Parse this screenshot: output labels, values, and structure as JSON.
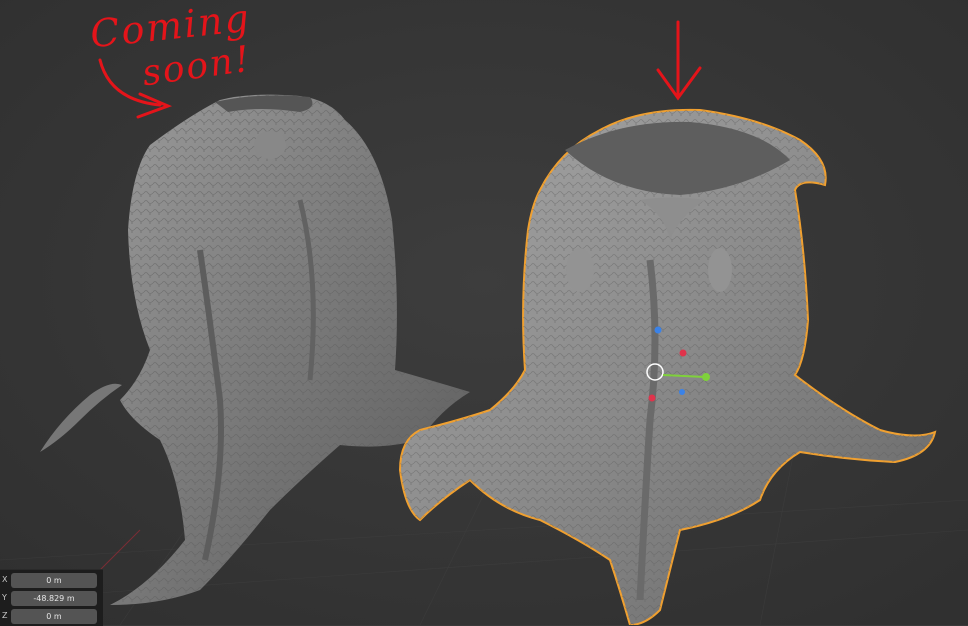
{
  "annotation": {
    "line1": "Coming",
    "line2": "soon!",
    "color": "#e4141a"
  },
  "viewport": {
    "background": "#393939",
    "selection_outline_color": "#f0a030",
    "gizmo_colors": {
      "x": "#e0334b",
      "y": "#7fd13b",
      "z": "#3a82e8"
    }
  },
  "transform_panel": {
    "fields": [
      {
        "axis": "X",
        "value": "0 m"
      },
      {
        "axis": "Y",
        "value": "-48.829 m"
      },
      {
        "axis": "Z",
        "value": "0 m"
      }
    ]
  }
}
